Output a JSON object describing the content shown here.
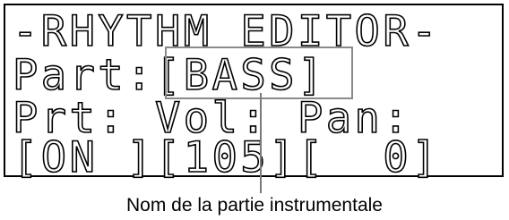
{
  "lcd": {
    "title": "-RHYTHM EDITOR-",
    "part_label": "Part:",
    "part_value": "[BASS]",
    "prt_label": "Prt:",
    "vol_label": "Vol:",
    "pan_label": "Pan:",
    "prt_value": "[ON ]",
    "vol_value": "[105]",
    "pan_value": "[  0]"
  },
  "caption": "Nom de la partie instrumentale"
}
